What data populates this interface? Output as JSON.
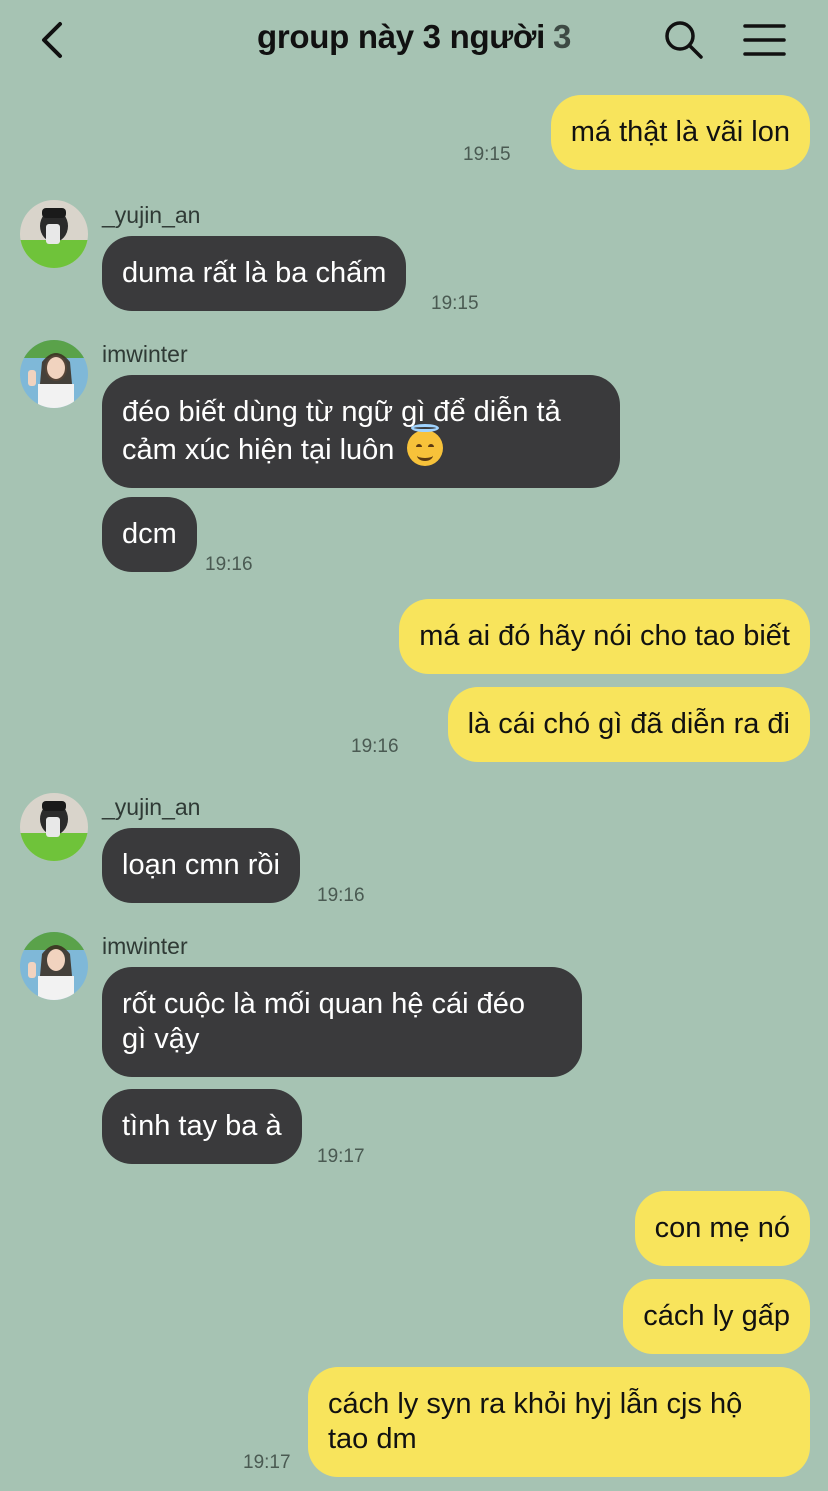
{
  "header": {
    "title": "group này 3 người",
    "member_count": "3"
  },
  "messages": [
    {
      "sender": "me",
      "text": "má thật là vãi lon",
      "time": "19:15"
    },
    {
      "sender": "_yujin_an",
      "text": "duma rất là ba chấm",
      "time": "19:15"
    },
    {
      "sender": "imwinter",
      "lines": [
        "đéo biết dùng từ ngữ gì để diễn tả",
        "cảm xúc hiện tại luôn"
      ],
      "emoji": "smiling-face-with-halo"
    },
    {
      "sender": "imwinter",
      "text": "dcm",
      "time": "19:16"
    },
    {
      "sender": "me",
      "text": "má ai đó hãy nói cho tao biết"
    },
    {
      "sender": "me",
      "text": "là cái chó gì đã diễn ra đi",
      "time": "19:16"
    },
    {
      "sender": "_yujin_an",
      "text": "loạn cmn rồi",
      "time": "19:16"
    },
    {
      "sender": "imwinter",
      "lines": [
        "rốt cuộc là mối quan hệ cái đéo",
        "gì vậy"
      ]
    },
    {
      "sender": "imwinter",
      "text": "tình tay ba à",
      "time": "19:17"
    },
    {
      "sender": "me",
      "text": "con mẹ nó"
    },
    {
      "sender": "me",
      "text": "cách ly gấp"
    },
    {
      "sender": "me",
      "lines": [
        "cách ly syn ra khỏi hyj lẫn cjs hộ",
        "tao dm"
      ],
      "time": "19:17"
    }
  ],
  "colors": {
    "background": "#a6c3b3",
    "my_bubble": "#f8e45c",
    "their_bubble": "#3a3a3c"
  },
  "icons": [
    "back-chevron-icon",
    "search-icon",
    "menu-icon"
  ]
}
